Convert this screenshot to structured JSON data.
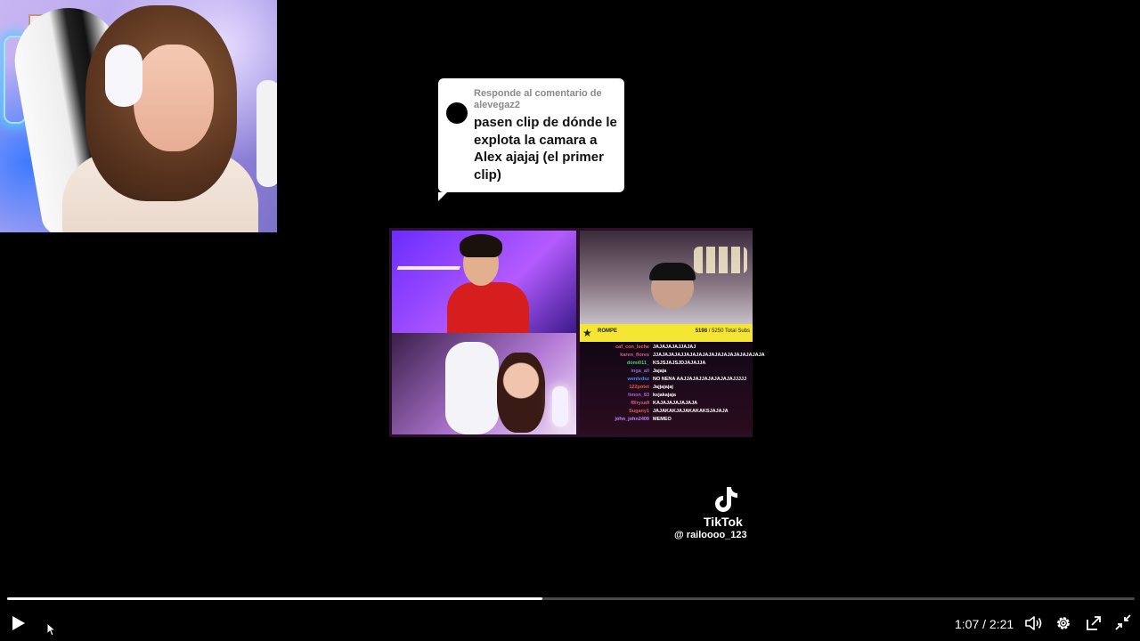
{
  "comment_bubble": {
    "reply_label": "Responde al comentario de alevegaz2",
    "comment_text": "pasen clip de dónde le explota la camara a Alex ajajaj (el primer clip)"
  },
  "inner_stream": {
    "sub_goal": {
      "label": "ROMPE",
      "current": "5198",
      "goal": "/ 5250 Total Subs"
    },
    "chat": [
      {
        "user": "caf_con_leche",
        "message": "JAJAJAJAJJAJAJ",
        "color": "#e86060"
      },
      {
        "user": "karen_flores",
        "message": "JJAJAJAJAJJAJAJAJAJAJAJAJAJAJAJAJAJA",
        "color": "#d85c8a"
      },
      {
        "user": "domi011_",
        "message": "KSJSJAJSJDJAJAJJA",
        "color": "#3cd07a"
      },
      {
        "user": "inga_all",
        "message": "Jajaja",
        "color": "#8a6ad8"
      },
      {
        "user": "wenlvdsz",
        "message": "NO NENA AAJJAJAJJAJAJAJAJAJJJJJ",
        "color": "#4a8cff"
      },
      {
        "user": "122potet",
        "message": "Jajjajajaj",
        "color": "#e85050"
      },
      {
        "user": "limon_83",
        "message": "ksjakajaja",
        "color": "#c05bd8"
      },
      {
        "user": "f8lrysa9",
        "message": "KAJAJAJAJAJAJA",
        "color": "#d95a7a"
      },
      {
        "user": "Sugany1",
        "message": "JAJAKAKJAJAKAKAKSJAJAJA",
        "color": "#e05a5a"
      },
      {
        "user": "john_john2409",
        "message": "MEMEO",
        "color": "#c080ff"
      }
    ]
  },
  "watermark": {
    "brand": "TikTok",
    "username": "@ railoooo_123"
  },
  "player": {
    "current_time": "1:07",
    "separator": "/",
    "duration": "2:21",
    "progress_fraction": 0.475
  }
}
